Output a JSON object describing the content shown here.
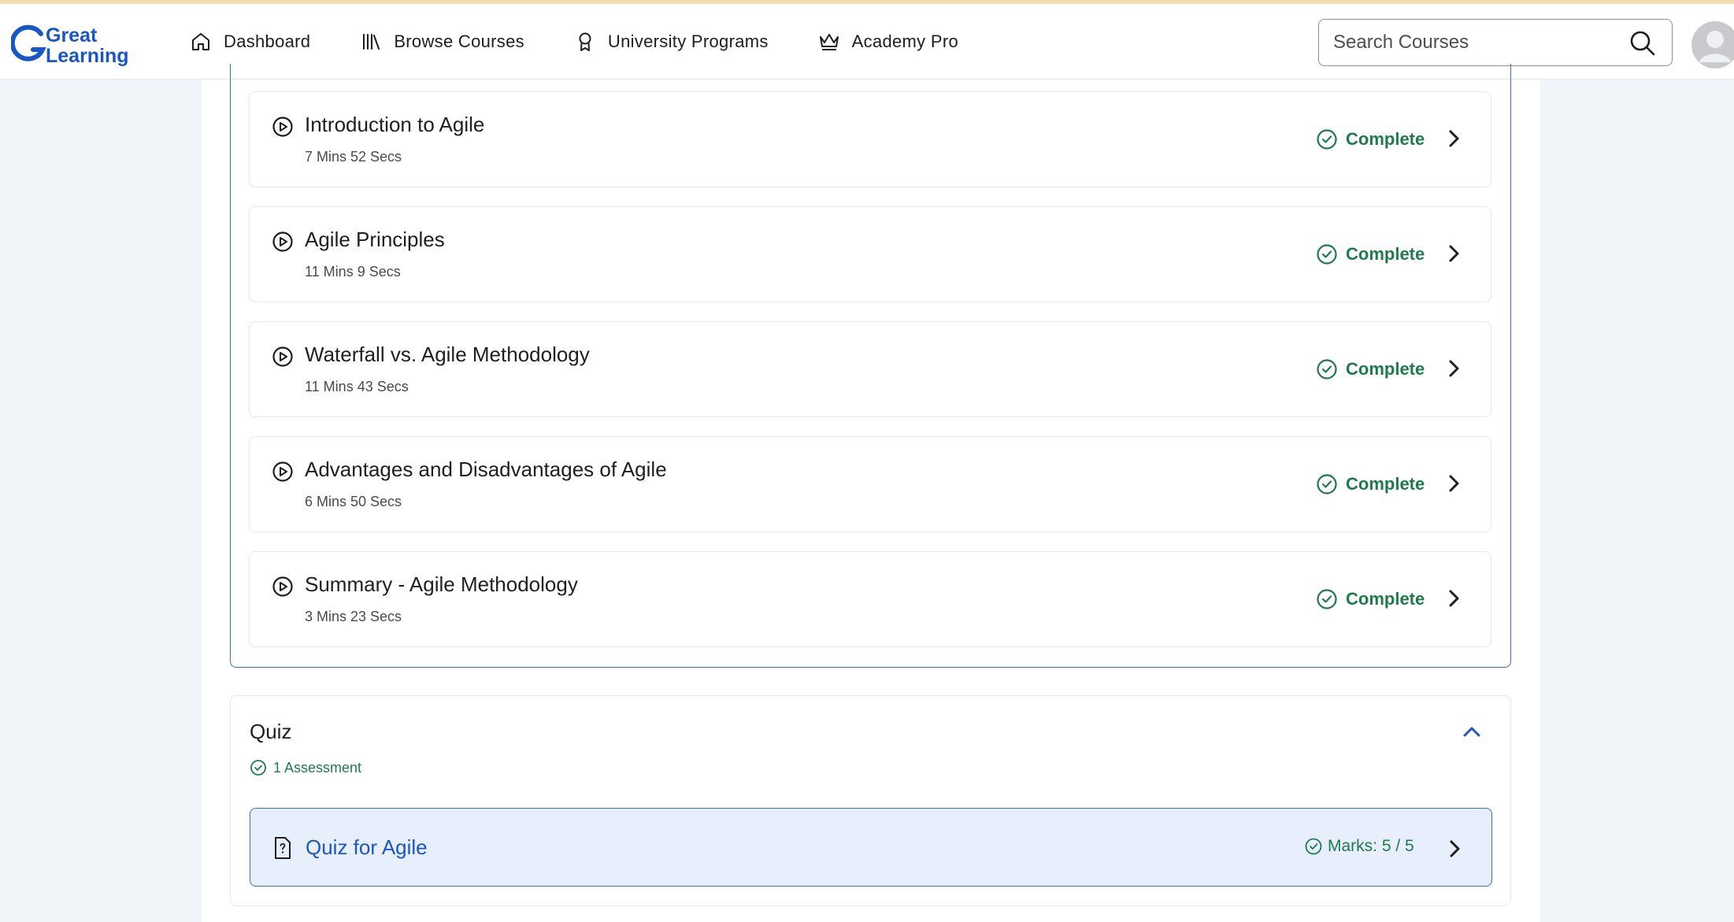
{
  "header": {
    "logo_line1": "Great",
    "logo_line2": "Learning",
    "nav": [
      {
        "label": "Dashboard",
        "icon": "home-icon"
      },
      {
        "label": "Browse Courses",
        "icon": "library-icon"
      },
      {
        "label": "University Programs",
        "icon": "award-icon"
      },
      {
        "label": "Academy Pro",
        "icon": "crown-icon"
      }
    ],
    "search_placeholder": "Search Courses"
  },
  "lessons": [
    {
      "title": "Introduction to Agile",
      "duration": "7 Mins 52 Secs",
      "status": "Complete"
    },
    {
      "title": "Agile Principles",
      "duration": "11 Mins 9 Secs",
      "status": "Complete"
    },
    {
      "title": "Waterfall vs. Agile Methodology",
      "duration": "11 Mins 43 Secs",
      "status": "Complete"
    },
    {
      "title": "Advantages and Disadvantages of Agile",
      "duration": "6 Mins 50 Secs",
      "status": "Complete"
    },
    {
      "title": "Summary - Agile Methodology",
      "duration": "3 Mins 23 Secs",
      "status": "Complete"
    }
  ],
  "quiz": {
    "section_title": "Quiz",
    "assessment_count": "1 Assessment",
    "item_title": "Quiz for Agile",
    "marks": "Marks: 5 / 5"
  },
  "colors": {
    "accent_blue": "#3a6fcf",
    "complete_green": "#1f7a4d",
    "logo_blue": "#1a56c4"
  }
}
